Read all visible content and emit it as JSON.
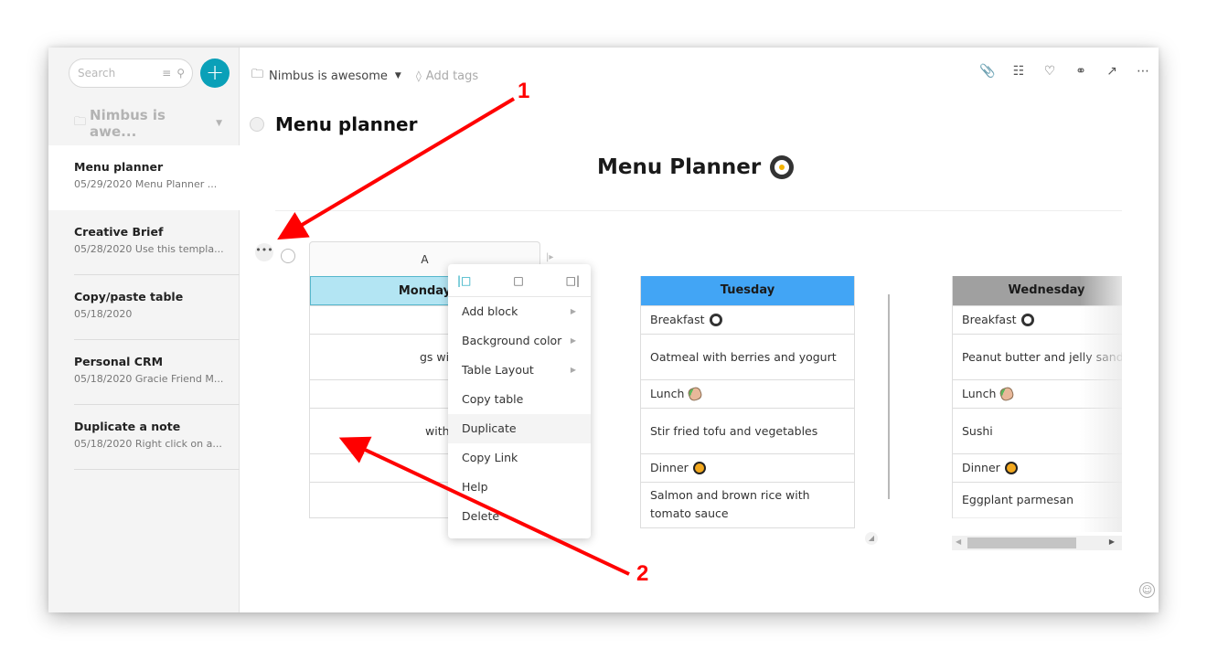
{
  "sidebar": {
    "search_placeholder": "Search",
    "add_button_label": "+",
    "folder_name": "Nimbus is awe...",
    "notes": [
      {
        "title": "Menu planner",
        "subtitle": "05/29/2020 Menu Planner ..."
      },
      {
        "title": "Creative Brief",
        "subtitle": "05/28/2020 Use this templa..."
      },
      {
        "title": "Copy/paste table",
        "subtitle": "05/18/2020"
      },
      {
        "title": "Personal CRM",
        "subtitle": "05/18/2020 Gracie Friend M..."
      },
      {
        "title": "Duplicate a note",
        "subtitle": "05/18/2020 Right click on a..."
      }
    ]
  },
  "topbar": {
    "folder": "Nimbus is awesome",
    "add_tags": "Add tags",
    "tools": [
      "attachment-icon",
      "outline-icon",
      "bell-icon",
      "share-icon",
      "expand-icon",
      "more-icon"
    ]
  },
  "note": {
    "title": "Menu planner",
    "doc_title": "Menu Planner"
  },
  "table_block": {
    "column_header": "A",
    "columns": [
      {
        "day": "Monday",
        "color": "#b3e5f3",
        "cells": [
          "",
          "...gs with cheese and",
          "",
          "... with smoothie",
          "",
          ""
        ]
      },
      {
        "day": "Tuesday",
        "color": "#42a5f5",
        "cells": [
          "Breakfast",
          "Oatmeal with berries and yogurt",
          "Lunch",
          "Stir fried tofu and vegetables",
          "Dinner",
          "Salmon and brown rice with tomato sauce"
        ]
      },
      {
        "day": "Wednesday",
        "color": "#a0a0a0",
        "cells": [
          "Breakfast",
          "Peanut butter and jelly sandwich",
          "Lunch",
          "Sushi",
          "Dinner",
          "Eggplant parmesan"
        ]
      }
    ],
    "monday_visible": {
      "row1": "gs with cheese and",
      "row3": "with smoothie"
    }
  },
  "context_menu": {
    "layout_icons": [
      "align-left-icon",
      "align-center-icon",
      "align-right-icon"
    ],
    "items": [
      {
        "label": "Add block",
        "submenu": true
      },
      {
        "label": "Background color",
        "submenu": true
      },
      {
        "label": "Table Layout",
        "submenu": true
      },
      {
        "label": "Copy table",
        "submenu": false
      },
      {
        "label": "Duplicate",
        "submenu": false,
        "hovered": true
      },
      {
        "label": "Copy Link",
        "submenu": false
      },
      {
        "label": "Help",
        "submenu": false
      },
      {
        "label": "Delete",
        "submenu": false
      }
    ]
  },
  "annotations": {
    "step1": "1",
    "step2": "2",
    "color": "#ff0000"
  }
}
